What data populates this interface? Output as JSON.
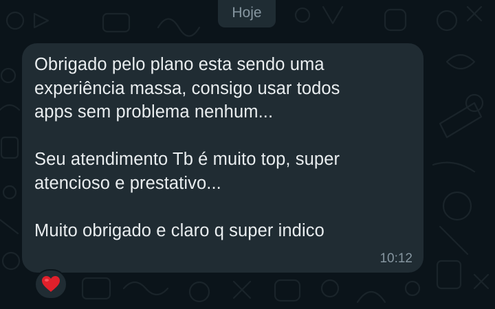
{
  "chat": {
    "date_label": "Hoje",
    "message": {
      "paragraphs": [
        "Obrigado pelo plano esta sendo uma\nexperiência massa, consigo usar todos\napps sem problema nenhum...",
        "Seu atendimento Tb é muito top, super\natencioso e prestativo...",
        "Muito obrigado e claro q super indico"
      ],
      "time": "10:12"
    },
    "reaction": {
      "icon": "red-heart-icon",
      "color": "#e0202b"
    }
  },
  "theme": {
    "background": "#0b141a",
    "bubble": "#202c33",
    "text": "#e9edef",
    "muted": "#8696a0"
  }
}
